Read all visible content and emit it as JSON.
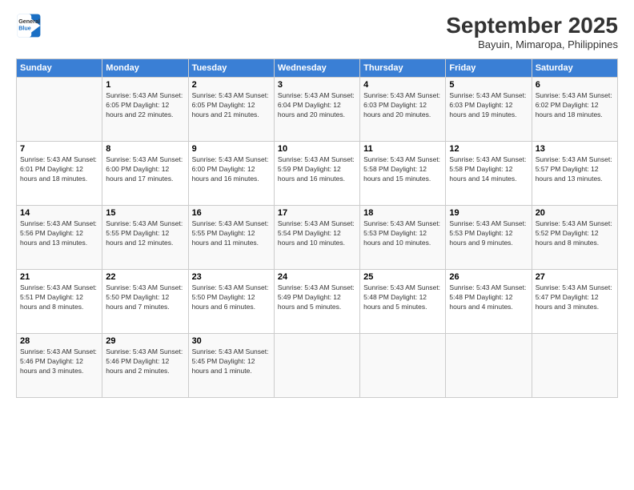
{
  "logo": {
    "line1": "General",
    "line2": "Blue"
  },
  "title": "September 2025",
  "subtitle": "Bayuin, Mimaropa, Philippines",
  "weekdays": [
    "Sunday",
    "Monday",
    "Tuesday",
    "Wednesday",
    "Thursday",
    "Friday",
    "Saturday"
  ],
  "weeks": [
    [
      {
        "day": "",
        "info": ""
      },
      {
        "day": "1",
        "info": "Sunrise: 5:43 AM\nSunset: 6:05 PM\nDaylight: 12 hours\nand 22 minutes."
      },
      {
        "day": "2",
        "info": "Sunrise: 5:43 AM\nSunset: 6:05 PM\nDaylight: 12 hours\nand 21 minutes."
      },
      {
        "day": "3",
        "info": "Sunrise: 5:43 AM\nSunset: 6:04 PM\nDaylight: 12 hours\nand 20 minutes."
      },
      {
        "day": "4",
        "info": "Sunrise: 5:43 AM\nSunset: 6:03 PM\nDaylight: 12 hours\nand 20 minutes."
      },
      {
        "day": "5",
        "info": "Sunrise: 5:43 AM\nSunset: 6:03 PM\nDaylight: 12 hours\nand 19 minutes."
      },
      {
        "day": "6",
        "info": "Sunrise: 5:43 AM\nSunset: 6:02 PM\nDaylight: 12 hours\nand 18 minutes."
      }
    ],
    [
      {
        "day": "7",
        "info": "Sunrise: 5:43 AM\nSunset: 6:01 PM\nDaylight: 12 hours\nand 18 minutes."
      },
      {
        "day": "8",
        "info": "Sunrise: 5:43 AM\nSunset: 6:00 PM\nDaylight: 12 hours\nand 17 minutes."
      },
      {
        "day": "9",
        "info": "Sunrise: 5:43 AM\nSunset: 6:00 PM\nDaylight: 12 hours\nand 16 minutes."
      },
      {
        "day": "10",
        "info": "Sunrise: 5:43 AM\nSunset: 5:59 PM\nDaylight: 12 hours\nand 16 minutes."
      },
      {
        "day": "11",
        "info": "Sunrise: 5:43 AM\nSunset: 5:58 PM\nDaylight: 12 hours\nand 15 minutes."
      },
      {
        "day": "12",
        "info": "Sunrise: 5:43 AM\nSunset: 5:58 PM\nDaylight: 12 hours\nand 14 minutes."
      },
      {
        "day": "13",
        "info": "Sunrise: 5:43 AM\nSunset: 5:57 PM\nDaylight: 12 hours\nand 13 minutes."
      }
    ],
    [
      {
        "day": "14",
        "info": "Sunrise: 5:43 AM\nSunset: 5:56 PM\nDaylight: 12 hours\nand 13 minutes."
      },
      {
        "day": "15",
        "info": "Sunrise: 5:43 AM\nSunset: 5:55 PM\nDaylight: 12 hours\nand 12 minutes."
      },
      {
        "day": "16",
        "info": "Sunrise: 5:43 AM\nSunset: 5:55 PM\nDaylight: 12 hours\nand 11 minutes."
      },
      {
        "day": "17",
        "info": "Sunrise: 5:43 AM\nSunset: 5:54 PM\nDaylight: 12 hours\nand 10 minutes."
      },
      {
        "day": "18",
        "info": "Sunrise: 5:43 AM\nSunset: 5:53 PM\nDaylight: 12 hours\nand 10 minutes."
      },
      {
        "day": "19",
        "info": "Sunrise: 5:43 AM\nSunset: 5:53 PM\nDaylight: 12 hours\nand 9 minutes."
      },
      {
        "day": "20",
        "info": "Sunrise: 5:43 AM\nSunset: 5:52 PM\nDaylight: 12 hours\nand 8 minutes."
      }
    ],
    [
      {
        "day": "21",
        "info": "Sunrise: 5:43 AM\nSunset: 5:51 PM\nDaylight: 12 hours\nand 8 minutes."
      },
      {
        "day": "22",
        "info": "Sunrise: 5:43 AM\nSunset: 5:50 PM\nDaylight: 12 hours\nand 7 minutes."
      },
      {
        "day": "23",
        "info": "Sunrise: 5:43 AM\nSunset: 5:50 PM\nDaylight: 12 hours\nand 6 minutes."
      },
      {
        "day": "24",
        "info": "Sunrise: 5:43 AM\nSunset: 5:49 PM\nDaylight: 12 hours\nand 5 minutes."
      },
      {
        "day": "25",
        "info": "Sunrise: 5:43 AM\nSunset: 5:48 PM\nDaylight: 12 hours\nand 5 minutes."
      },
      {
        "day": "26",
        "info": "Sunrise: 5:43 AM\nSunset: 5:48 PM\nDaylight: 12 hours\nand 4 minutes."
      },
      {
        "day": "27",
        "info": "Sunrise: 5:43 AM\nSunset: 5:47 PM\nDaylight: 12 hours\nand 3 minutes."
      }
    ],
    [
      {
        "day": "28",
        "info": "Sunrise: 5:43 AM\nSunset: 5:46 PM\nDaylight: 12 hours\nand 3 minutes."
      },
      {
        "day": "29",
        "info": "Sunrise: 5:43 AM\nSunset: 5:46 PM\nDaylight: 12 hours\nand 2 minutes."
      },
      {
        "day": "30",
        "info": "Sunrise: 5:43 AM\nSunset: 5:45 PM\nDaylight: 12 hours\nand 1 minute."
      },
      {
        "day": "",
        "info": ""
      },
      {
        "day": "",
        "info": ""
      },
      {
        "day": "",
        "info": ""
      },
      {
        "day": "",
        "info": ""
      }
    ]
  ]
}
